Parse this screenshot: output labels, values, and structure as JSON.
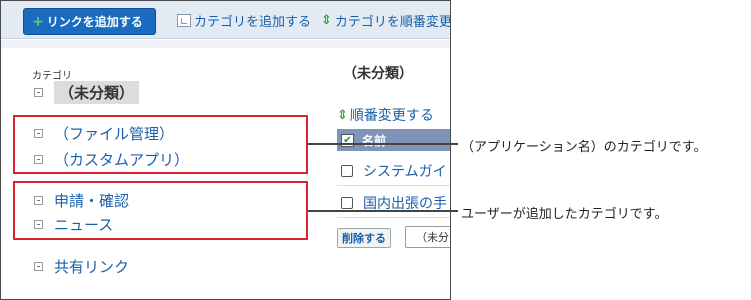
{
  "toolbar": {
    "add_link_label": "リンクを追加する",
    "add_category_label": "カテゴリを追加する",
    "reorder_category_label": "カテゴリを順番変更"
  },
  "sidebar": {
    "heading": "カテゴリ",
    "items": [
      {
        "label": "（未分類）"
      },
      {
        "label": "（ファイル管理）"
      },
      {
        "label": "（カスタムアプリ）"
      },
      {
        "label": "申請・確認"
      },
      {
        "label": "ニュース"
      },
      {
        "label": "共有リンク"
      }
    ]
  },
  "main": {
    "title": "（未分類）",
    "reorder_label": "順番変更する",
    "column_name": "名前",
    "rows": [
      {
        "name": "システムガイ"
      },
      {
        "name": "国内出張の手"
      }
    ],
    "delete_label": "削除する",
    "move_select_value": "（未分"
  },
  "annotations": {
    "app_categories": "（アプリケーション名）のカテゴリです。",
    "user_categories": "ユーザーが追加したカテゴリです。"
  },
  "colors": {
    "toolbar_bg": "#e2eaf3",
    "primary_button": "#1a6cc0",
    "link": "#1a5fa8",
    "table_header": "#7f94b8",
    "callout": "#d9262c"
  }
}
